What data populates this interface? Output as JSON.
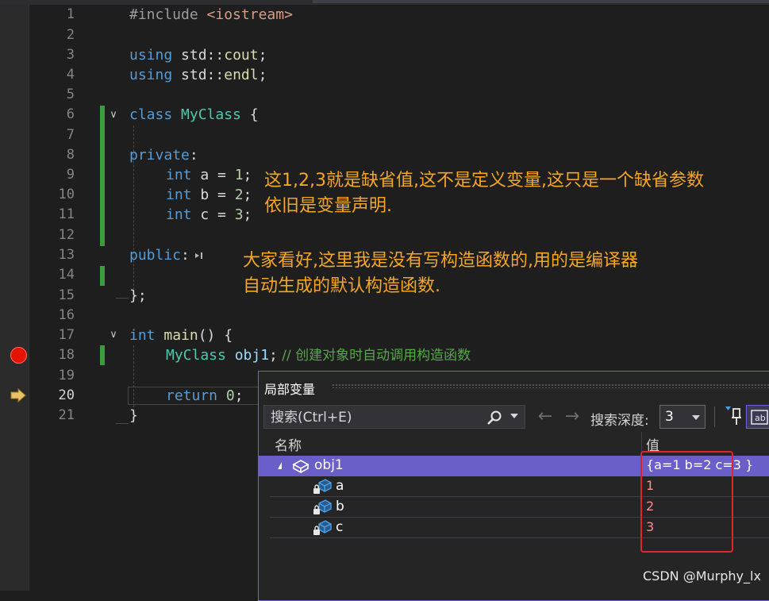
{
  "editor": {
    "line_numbers": [
      "1",
      "2",
      "3",
      "4",
      "5",
      "6",
      "7",
      "8",
      "9",
      "10",
      "11",
      "12",
      "13",
      "14",
      "15",
      "16",
      "17",
      "18",
      "19",
      "20",
      "21"
    ],
    "current_line": "20",
    "code": {
      "l1_directive": "#include",
      "l1_header": "<iostream>",
      "l3_using": "using",
      "l3_ns": "std",
      "l3_sep": "::",
      "l3_name": "cout",
      "l3_semi": ";",
      "l4_using": "using",
      "l4_ns": "std",
      "l4_sep": "::",
      "l4_name": "endl",
      "l4_semi": ";",
      "l6_class": "class",
      "l6_name": "MyClass",
      "l6_brace": " {",
      "l8_private": "private",
      "l8_colon": ":",
      "l9_type": "int",
      "l9_rest": " a = ",
      "l9_num": "1",
      "l9_semi": ";",
      "l10_type": "int",
      "l10_rest": " b = ",
      "l10_num": "2",
      "l10_semi": ";",
      "l11_type": "int",
      "l11_rest": " c = ",
      "l11_num": "3",
      "l11_semi": ";",
      "l13_public": "public",
      "l13_colon": ":",
      "l15_close": "};",
      "l17_type": "int",
      "l17_fn": "main",
      "l17_rest": "() {",
      "l18_class": "MyClass",
      "l18_obj": " obj1",
      "l18_semi": ";",
      "l18_comment": " // 创建对象时自动调用构造函数",
      "l20_return": "return",
      "l20_num": "0",
      "l20_semi": ";",
      "l21_close": "}"
    }
  },
  "annotations": {
    "note1_line1": "这1,2,3就是缺省值,这不是定义变量,这只是一个缺省参数",
    "note1_line2": "依旧是变量声明.",
    "note2_line1": "大家看好,这里我是没有写构造函数的,用的是编译器",
    "note2_line2": "自动生成的默认构造函数."
  },
  "locals": {
    "title": "局部变量",
    "search_placeholder": "搜索(Ctrl+E)",
    "depth_label": "搜索深度:",
    "depth_value": "3",
    "col_name": "名称",
    "col_value": "值",
    "rows": [
      {
        "name": "obj1",
        "value": "{a=1 b=2 c=3 }"
      },
      {
        "name": "a",
        "value": "1"
      },
      {
        "name": "b",
        "value": "2"
      },
      {
        "name": "c",
        "value": "3"
      }
    ]
  },
  "watermark": "CSDN @Murphy_lx",
  "colors": {
    "accent_purple": "#7160e8",
    "annotation_orange": "#f5a623",
    "breakpoint_red": "#e51400",
    "highlight_red": "#e0262a"
  }
}
